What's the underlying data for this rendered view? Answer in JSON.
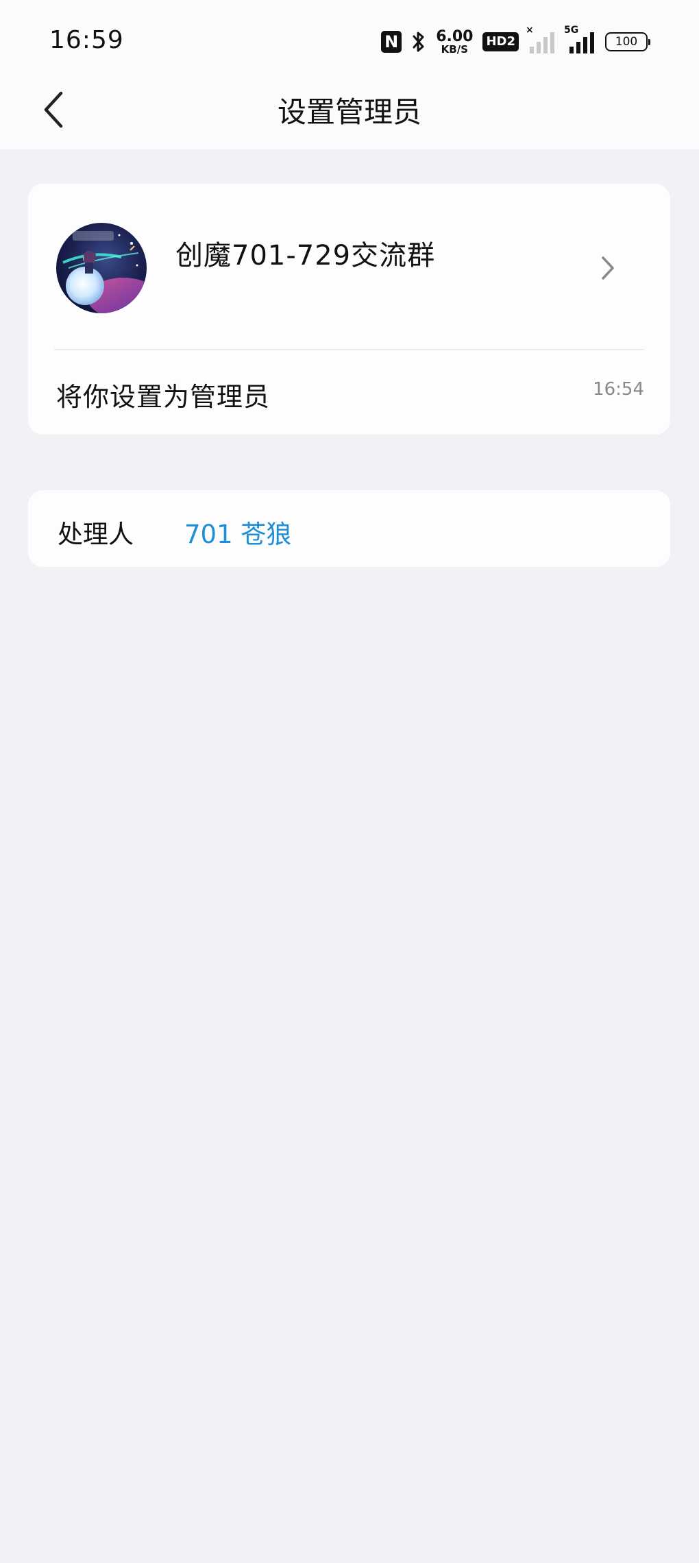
{
  "status_bar": {
    "time": "16:59",
    "nfc": "N",
    "speed_value": "6.00",
    "speed_unit": "KB/S",
    "hd": "HD2",
    "network": "5G",
    "battery": "100"
  },
  "header": {
    "title": "设置管理员",
    "back_icon": "chevron-left-icon"
  },
  "group_card": {
    "group_name": "创魔701-729交流群",
    "arrow_icon": "chevron-right-icon",
    "message": "将你设置为管理员",
    "time": "16:54"
  },
  "handler_card": {
    "label": "处理人",
    "name": "701 苍狼"
  },
  "colors": {
    "background": "#f2f2f6",
    "card": "#fdfdfe",
    "link": "#1e8fd6"
  }
}
